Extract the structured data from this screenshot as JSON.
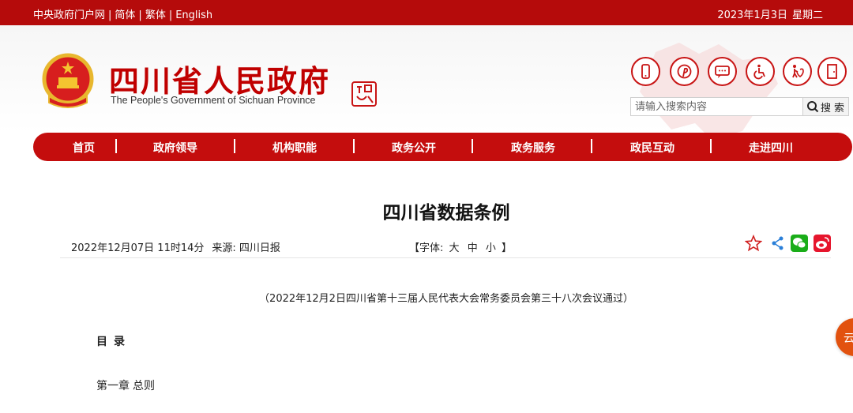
{
  "topbar": {
    "links": [
      "中央政府门户网",
      "简体",
      "繁体",
      "English"
    ],
    "date": "2023年1月3日",
    "weekday": "星期二"
  },
  "header": {
    "title_cn": "四川省人民政府",
    "title_en": "The People's Government of Sichuan Province",
    "search_placeholder": "请输入搜索内容",
    "search_button": "搜索",
    "icons": [
      "mobile-icon",
      "weibo-pin-icon",
      "message-icon",
      "accessibility-icon",
      "elderly-care-icon",
      "exit-icon"
    ]
  },
  "nav": {
    "items": [
      "首页",
      "政府领导",
      "机构职能",
      "政务公开",
      "政务服务",
      "政民互动",
      "走进四川"
    ]
  },
  "article": {
    "title": "四川省数据条例",
    "date": "2022年12月07日 11时14分",
    "source": "来源: 四川日报",
    "font_label_open": "【字体:",
    "font_large": "大",
    "font_medium": "中",
    "font_small": "小",
    "font_label_close": "】",
    "subtitle": "（2022年12月2日四川省第十三届人民代表大会常务委员会第三十八次会议通过）",
    "toc_heading": "目录",
    "chapter1": "第一章",
    "chapter1_name": "总则"
  },
  "share": [
    "star-icon",
    "share-icon",
    "wechat-icon",
    "weibo-icon"
  ],
  "float_button": "云",
  "colors": {
    "brand_red": "#c40d0d",
    "topbar_red": "#b50b0b",
    "float_orange": "#e2520f"
  }
}
